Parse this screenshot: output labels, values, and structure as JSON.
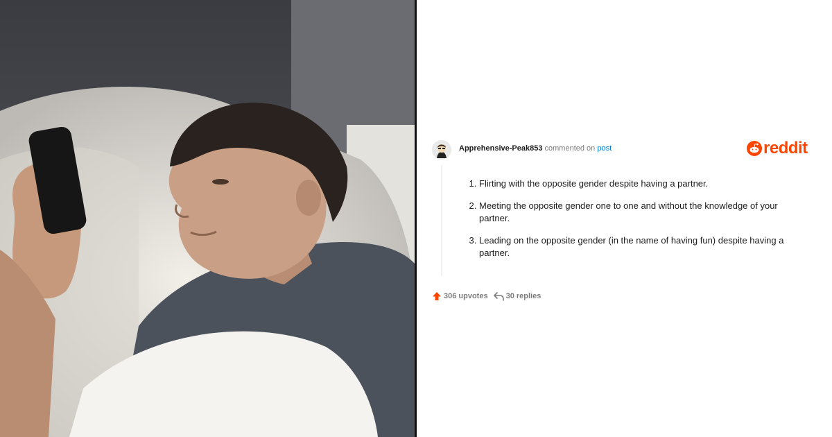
{
  "photo": {
    "alt": "",
    "icon": "photo-man-in-bed-with-phone"
  },
  "comment": {
    "username": "Apprehensive-Peak853",
    "action_text": "commented on",
    "post_link_label": "post",
    "items": [
      "Flirting with the opposite gender despite having a partner.",
      "Meeting the opposite gender one to one and without the knowledge of your partner.",
      "Leading on the opposite gender (in the name of having fun) despite having a partner."
    ],
    "upvotes_label": "306 upvotes",
    "replies_label": "30 replies"
  },
  "brand": {
    "logo_text": "reddit",
    "accent": "#ff4500",
    "link_color": "#0079d3"
  }
}
